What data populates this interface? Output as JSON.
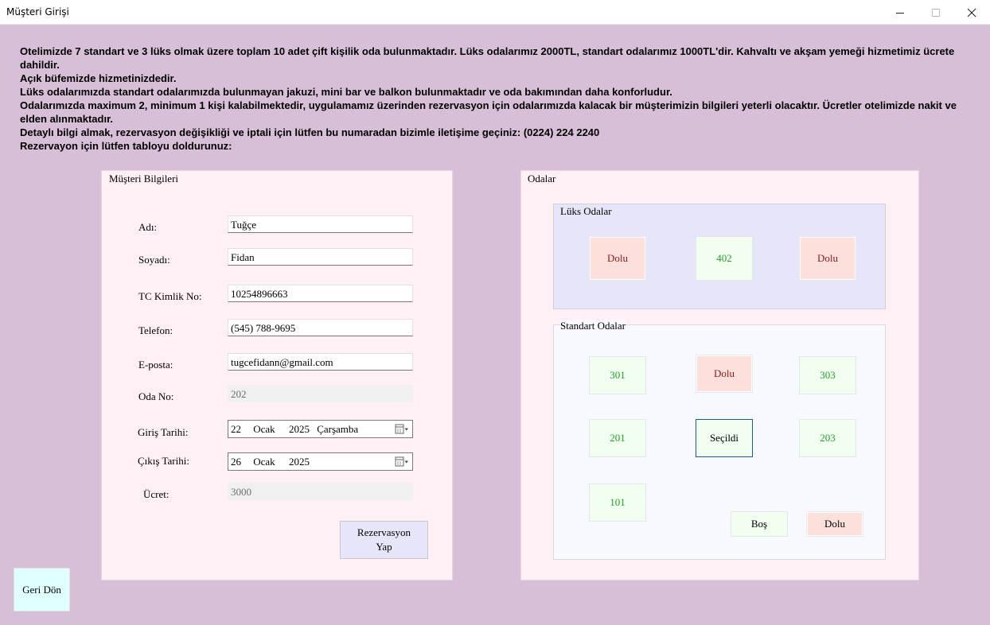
{
  "window": {
    "title": "Müşteri Girişi",
    "minimize_icon": "minimize-icon",
    "maximize_icon": "maximize-icon",
    "close_icon": "close-icon"
  },
  "intro": [
    "Otelimizde 7 standart ve 3 lüks olmak üzere toplam 10 adet çift kişilik oda bulunmaktadır. Lüks odalarımız 2000TL, standart odalarımız 1000TL'dir. Kahvaltı ve akşam yemeği hizmetimiz ücrete dahildir.",
    "Açık büfemizde hizmetinizdedir.",
    "Lüks odalarımızda standart odalarımızda bulunmayan jakuzi, mini bar ve balkon bulunmaktadır ve oda bakımından daha konforludur.",
    "Odalarımızda maximum 2, minimum 1 kişi kalabilmektedir, uygulamamız üzerinden rezervasyon için odalarımızda kalacak bir müşterimizin bilgileri yeterli olacaktır.  Ücretler otelimizde nakit ve elden alınmaktadır.",
    "Detaylı bilgi almak, rezervasyon değişikliği ve iptali için lütfen bu numaradan bizimle iletişime geçiniz: (0224) 224 2240",
    "Rezervayon için lütfen tabloyu doldurunuz:"
  ],
  "customer": {
    "legend": "Müşteri Bilgileri",
    "first_name_label": "Adı:",
    "first_name_value": "Tuğçe",
    "last_name_label": "Soyadı:",
    "last_name_value": "Fidan",
    "tc_label": "TC Kimlik No:",
    "tc_value": "10254896663",
    "phone_label": "Telefon:",
    "phone_value": "(545) 788-9695",
    "email_label": "E-posta:",
    "email_value": "tugcefidann@gmail.com",
    "room_label": "Oda No:",
    "room_value": "202",
    "checkin_label": "Giriş Tarihi:",
    "checkin": {
      "day": "22",
      "month": "Ocak",
      "year": "2025",
      "weekday": "Çarşamba"
    },
    "checkout_label": "Çıkış Tarihi:",
    "checkout": {
      "day": "26",
      "month": "Ocak",
      "year": "2025"
    },
    "fee_label": "Ücret:",
    "fee_value": "3000",
    "reserve_button_line1": "Rezervasyon",
    "reserve_button_line2": "Yap"
  },
  "rooms": {
    "legend": "Odalar",
    "luxury_legend": "Lüks Odalar",
    "luxury": [
      "Dolu",
      "402",
      "Dolu"
    ],
    "standard_legend": "Standart Odalar",
    "standard": [
      "301",
      "Dolu",
      "303",
      "201",
      "Seçildi",
      "203",
      "101"
    ],
    "key_empty": "Boş",
    "key_full": "Dolu"
  },
  "back_button": "Geri Dön",
  "colors": {
    "background": "#d8bfd8",
    "panel": "#fff0f5",
    "luxury_panel": "#e6e6fa",
    "standard_panel": "#f8f8ff",
    "full_room": "#fde0dc",
    "empty_room": "#f0fff0",
    "back_button": "#e0ffff"
  }
}
